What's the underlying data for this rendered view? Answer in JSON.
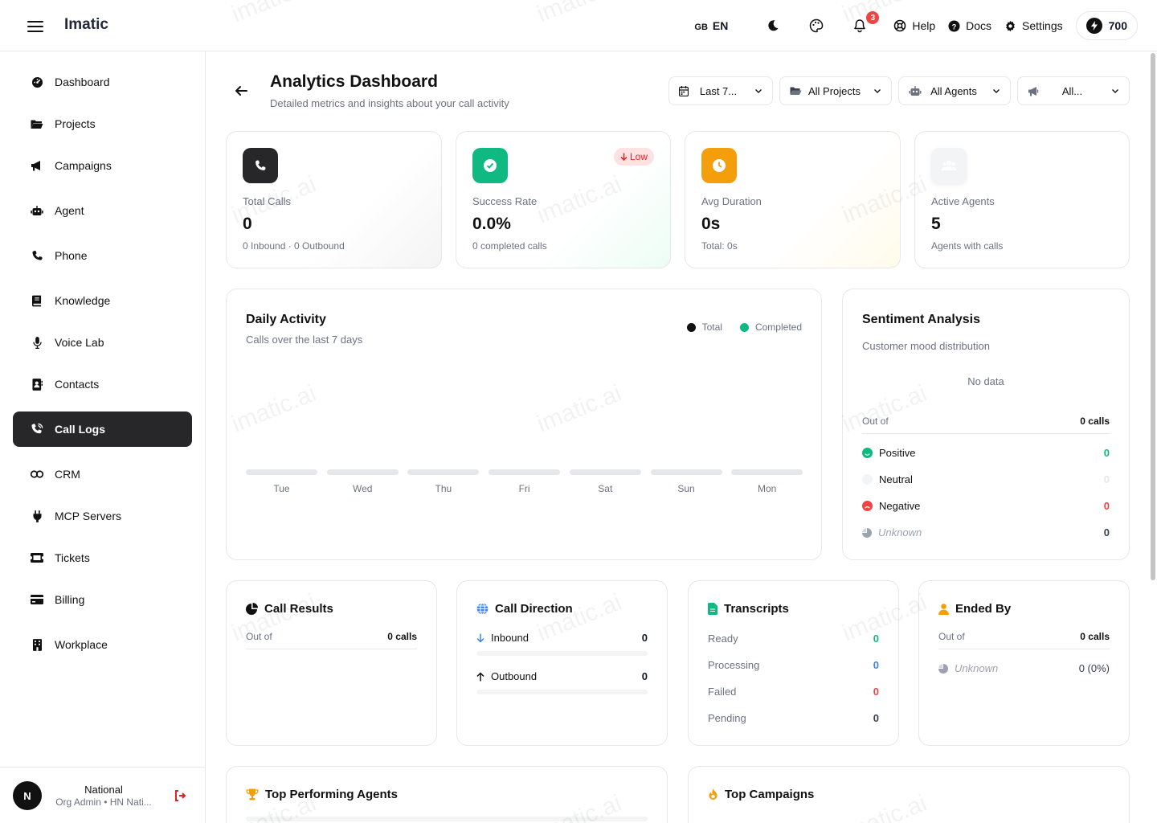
{
  "app": {
    "brand": "Imatic"
  },
  "topbar": {
    "lang_flag": "GB",
    "lang_code": "EN",
    "notif_count": "3",
    "help": "Help",
    "docs": "Docs",
    "settings": "Settings",
    "credits": "700"
  },
  "sidebar": {
    "items": [
      {
        "label": "Dashboard",
        "icon": "dashboard-icon"
      },
      {
        "label": "Projects",
        "icon": "folder-icon"
      },
      {
        "label": "Campaigns",
        "icon": "megaphone-icon"
      },
      {
        "label": "Agent",
        "icon": "robot-icon"
      },
      {
        "label": "Phone",
        "icon": "phone-icon"
      },
      {
        "label": "Knowledge",
        "icon": "book-icon"
      },
      {
        "label": "Voice Lab",
        "icon": "microphone-icon"
      },
      {
        "label": "Contacts",
        "icon": "contacts-icon"
      },
      {
        "label": "Call Logs",
        "icon": "phone-volume-icon",
        "active": true
      },
      {
        "label": "CRM",
        "icon": "link-icon"
      },
      {
        "label": "MCP Servers",
        "icon": "plug-icon"
      },
      {
        "label": "Tickets",
        "icon": "ticket-icon"
      },
      {
        "label": "Billing",
        "icon": "credit-card-icon"
      },
      {
        "label": "Workplace",
        "icon": "building-icon"
      }
    ],
    "user": {
      "initial": "N",
      "name": "National",
      "role": "Org Admin • HN Nati..."
    }
  },
  "header": {
    "title": "Analytics Dashboard",
    "subtitle": "Detailed metrics and insights about your call activity",
    "filters": {
      "range": "Last 7...",
      "projects": "All Projects",
      "agents": "All Agents",
      "campaigns": "All..."
    }
  },
  "stats": {
    "total_calls": {
      "label": "Total Calls",
      "value": "0",
      "sub": "0 Inbound · 0 Outbound"
    },
    "success_rate": {
      "label": "Success Rate",
      "value": "0.0%",
      "sub": "0 completed calls",
      "badge": "Low"
    },
    "avg_duration": {
      "label": "Avg Duration",
      "value": "0s",
      "sub": "Total: 0s"
    },
    "active_agents": {
      "label": "Active Agents",
      "value": "5",
      "sub": "Agents with calls"
    }
  },
  "daily": {
    "title": "Daily Activity",
    "subtitle": "Calls over the last 7 days",
    "legend_total": "Total",
    "legend_completed": "Completed",
    "days": [
      "Tue",
      "Wed",
      "Thu",
      "Fri",
      "Sat",
      "Sun",
      "Mon"
    ]
  },
  "sentiment": {
    "title": "Sentiment Analysis",
    "subtitle": "Customer mood distribution",
    "no_data": "No data",
    "out_of_label": "Out of",
    "out_of_value": "0 calls",
    "rows": [
      {
        "label": "Positive",
        "value": "0",
        "color": "#10b981"
      },
      {
        "label": "Neutral",
        "value": "0",
        "color": "#e5e7eb"
      },
      {
        "label": "Negative",
        "value": "0",
        "color": "#ef4444"
      },
      {
        "label": "Unknown",
        "value": "0",
        "color": "#9ca3af"
      }
    ]
  },
  "call_results": {
    "title": "Call Results",
    "out_of_label": "Out of",
    "out_of_value": "0 calls"
  },
  "call_direction": {
    "title": "Call Direction",
    "inbound_label": "Inbound",
    "inbound_value": "0",
    "outbound_label": "Outbound",
    "outbound_value": "0"
  },
  "transcripts": {
    "title": "Transcripts",
    "rows": [
      {
        "label": "Ready",
        "value": "0",
        "color": "#10b981"
      },
      {
        "label": "Processing",
        "value": "0",
        "color": "#3b82f6"
      },
      {
        "label": "Failed",
        "value": "0",
        "color": "#ef4444"
      },
      {
        "label": "Pending",
        "value": "0",
        "color": "#374151"
      }
    ]
  },
  "ended_by": {
    "title": "Ended By",
    "out_of_label": "Out of",
    "out_of_value": "0 calls",
    "unknown_label": "Unknown",
    "unknown_value": "0 (0%)"
  },
  "top_agents": {
    "title": "Top Performing Agents"
  },
  "top_campaigns": {
    "title": "Top Campaigns"
  },
  "watermark": "imatic.ai"
}
